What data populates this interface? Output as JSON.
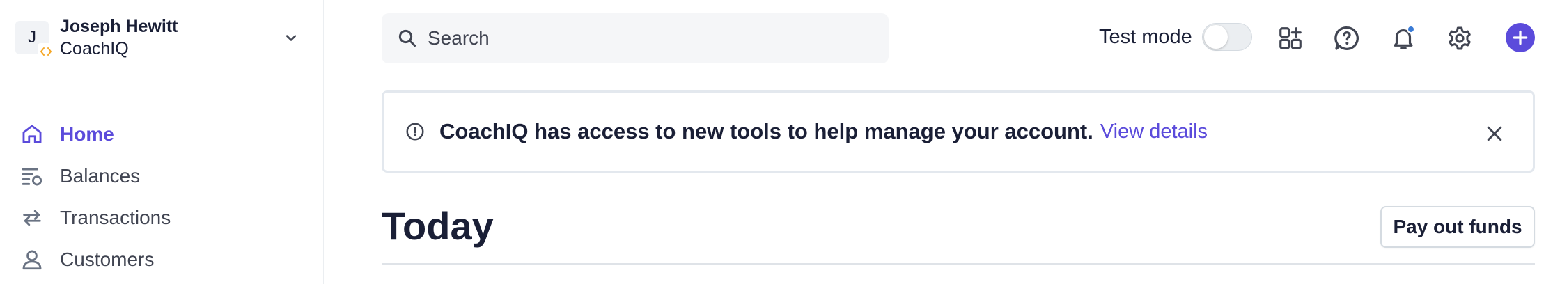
{
  "account": {
    "avatar_initial": "J",
    "name": "Joseph Hewitt",
    "org": "CoachIQ"
  },
  "nav": {
    "items": [
      {
        "label": "Home",
        "icon": "home-icon",
        "active": true
      },
      {
        "label": "Balances",
        "icon": "balances-icon",
        "active": false
      },
      {
        "label": "Transactions",
        "icon": "transactions-icon",
        "active": false
      },
      {
        "label": "Customers",
        "icon": "customers-icon",
        "active": false
      }
    ]
  },
  "search": {
    "placeholder": "Search"
  },
  "topbar": {
    "test_mode_label": "Test mode",
    "test_mode_on": false,
    "icons": [
      "apps-icon",
      "help-icon",
      "bell-icon",
      "gear-icon",
      "plus-icon"
    ]
  },
  "banner": {
    "message": "CoachIQ has access to new tools to help manage your account.",
    "link_label": "View details"
  },
  "page": {
    "title": "Today",
    "payout_label": "Pay out funds"
  },
  "colors": {
    "accent": "#5b4bdb",
    "text": "#1a1f36",
    "notification_dot": "#3a7bd5"
  }
}
